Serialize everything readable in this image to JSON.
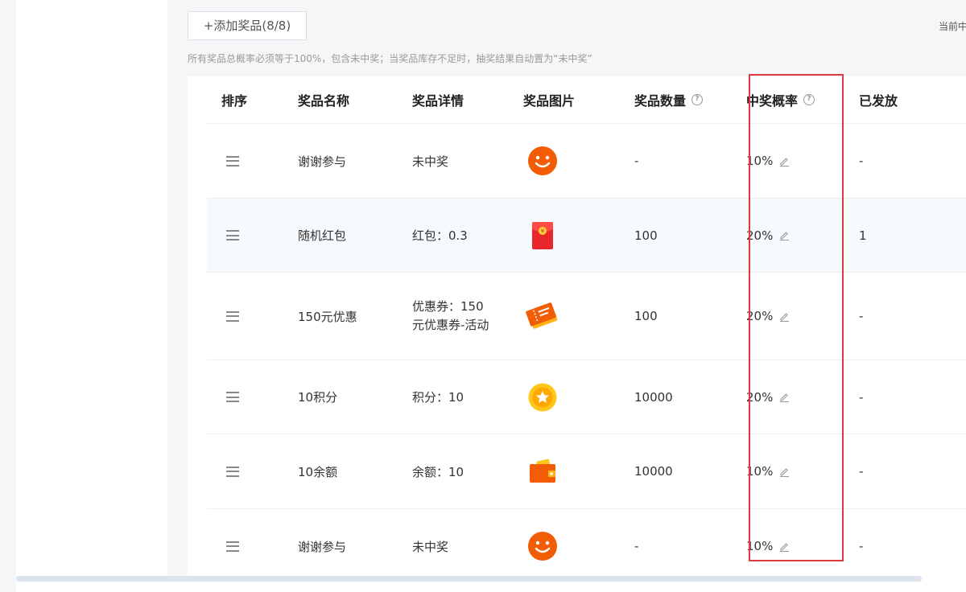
{
  "toolbar": {
    "add_prize_label": "+添加奖品(8/8)",
    "top_right_text": "当前中"
  },
  "hint": "所有奖品总概率必须等于100%，包含未中奖；当奖品库存不足时，抽奖结果自动置为“未中奖”",
  "table": {
    "headers": {
      "sort": "排序",
      "name": "奖品名称",
      "detail": "奖品详情",
      "image": "奖品图片",
      "quantity": "奖品数量",
      "probability": "中奖概率",
      "issued": "已发放"
    },
    "help_glyph": "?",
    "rows": [
      {
        "name": "谢谢参与",
        "detail": "未中奖",
        "icon": "smiley-icon",
        "quantity": "-",
        "probability": "10%",
        "issued": "-"
      },
      {
        "name": "随机红包",
        "detail": "红包：0.3",
        "icon": "red-envelope-icon",
        "quantity": "100",
        "probability": "20%",
        "issued": "1"
      },
      {
        "name": "150元优惠",
        "detail": "优惠券：150元优惠券-活动",
        "icon": "coupon-icon",
        "quantity": "100",
        "probability": "20%",
        "issued": "-"
      },
      {
        "name": "10积分",
        "detail": "积分：10",
        "icon": "star-coin-icon",
        "quantity": "10000",
        "probability": "20%",
        "issued": "-"
      },
      {
        "name": "10余额",
        "detail": "余额：10",
        "icon": "wallet-icon",
        "quantity": "10000",
        "probability": "10%",
        "issued": "-"
      },
      {
        "name": "谢谢参与",
        "detail": "未中奖",
        "icon": "smiley-icon",
        "quantity": "-",
        "probability": "10%",
        "issued": "-"
      }
    ]
  },
  "colors": {
    "highlight_box": "#e0393e",
    "accent_orange": "#f25c05"
  }
}
